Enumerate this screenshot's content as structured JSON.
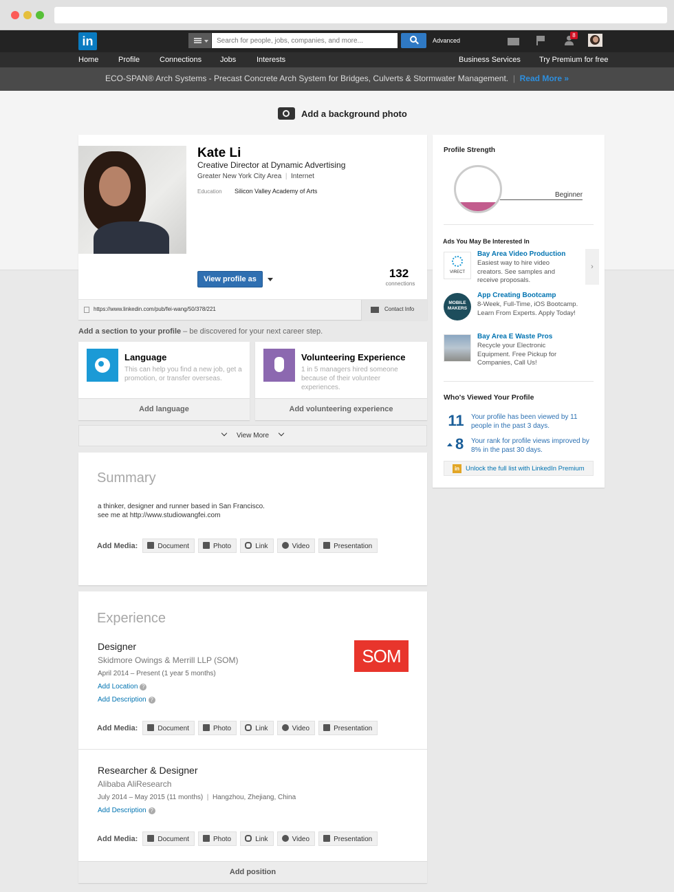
{
  "topnav": {
    "search_placeholder": "Search for people, jobs, companies, and more...",
    "advanced": "Advanced",
    "notification_count": "8",
    "menu": [
      "Home",
      "Profile",
      "Connections",
      "Jobs",
      "Interests"
    ],
    "right": [
      "Business Services",
      "Try Premium for free"
    ]
  },
  "adbar": {
    "text": "ECO-SPAN® Arch Systems - Precast Concrete Arch System for Bridges, Culverts & Stormwater Management.",
    "link": "Read More »"
  },
  "background_photo": {
    "label": "Add a background photo"
  },
  "profile": {
    "name": "Kate Li",
    "headline": "Creative Director at Dynamic Advertising",
    "location": "Greater New York City Area",
    "industry": "Internet",
    "education_label": "Education",
    "education": "Silicon Valley Academy of Arts",
    "view_as": "View profile as",
    "connections_count": "132",
    "connections_label": "connections",
    "url": "https://www.linkedin.com/pub/fei-wang/50/378/221",
    "contact_info": "Contact Info"
  },
  "add_section": {
    "title": "Add a section to your profile",
    "subtitle": " – be discovered for your next career step.",
    "cards": [
      {
        "title": "Language",
        "desc": "This can help you find a new job, get a promotion, or transfer overseas.",
        "action": "Add language",
        "color": "#1b9ad6"
      },
      {
        "title": "Volunteering Experience",
        "desc": "1 in 5 managers hired someone because of their volunteer experiences.",
        "action": "Add volunteering experience",
        "color": "#8c68b0"
      }
    ],
    "view_more": "View More"
  },
  "summary": {
    "title": "Summary",
    "line1": "a thinker, designer and runner based in San Francisco.",
    "line2": "see me at http://www.studiowangfei.com"
  },
  "media": {
    "label": "Add Media:",
    "buttons": [
      "Document",
      "Photo",
      "Link",
      "Video",
      "Presentation"
    ]
  },
  "experience": {
    "title": "Experience",
    "positions": [
      {
        "title": "Designer",
        "company": "Skidmore Owings & Merrill LLP (SOM)",
        "dates": "April 2014 – Present (1 year 5 months)",
        "add_location": "Add Location",
        "add_description": "Add Description",
        "logo": "SOM"
      },
      {
        "title": "Researcher & Designer",
        "company": "Alibaba AliResearch",
        "dates": "July 2014 – May 2015 (11 months)",
        "place": "Hangzhou, Zhejiang, China",
        "add_description": "Add Description"
      }
    ],
    "add_position": "Add position"
  },
  "sidebar": {
    "strength_title": "Profile Strength",
    "strength_level": "Beginner",
    "strength_fill": 0.2,
    "ads_title": "Ads You May Be Interested In",
    "ads": [
      {
        "title": "Bay Area Video Production",
        "desc": "Easiest way to hire video creators. See samples and receive proposals.",
        "logo": "VIRECT"
      },
      {
        "title": "App Creating Bootcamp",
        "desc": "8-Week, Full-Time, iOS Bootcamp. Learn From Experts. Apply Today!",
        "logo": "MOBILE MAKERS"
      },
      {
        "title": "Bay Area E Waste Pros",
        "desc": "Recycle your Electronic Equipment. Free Pickup for Companies, Call Us!"
      }
    ],
    "viewed_title": "Who's Viewed Your Profile",
    "views_count": "11",
    "views_text": "Your profile has been viewed by 11 people in the past 3 days.",
    "rank_count": "8",
    "rank_text": "Your rank for profile views improved by 8% in the past 30 days.",
    "unlock": "Unlock the full list with LinkedIn Premium"
  }
}
